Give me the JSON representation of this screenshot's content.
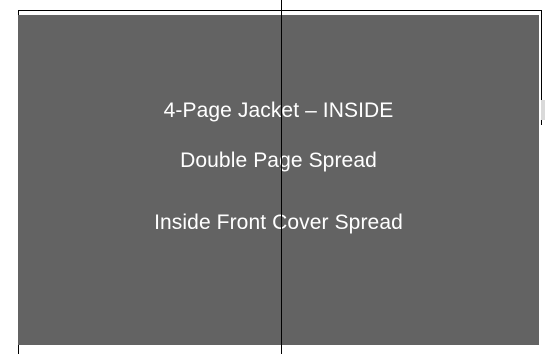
{
  "panel": {
    "lines": [
      "4-Page Jacket – INSIDE",
      "Double Page Spread",
      "Inside Front Cover Spread"
    ]
  },
  "colors": {
    "panel_fill": "#636363",
    "text": "#ffffff",
    "outline": "#000000"
  }
}
